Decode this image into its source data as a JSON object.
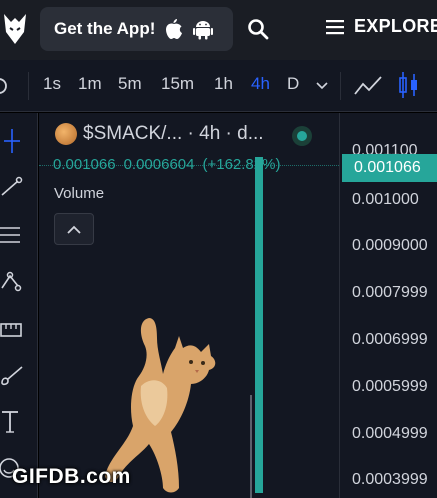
{
  "app": {
    "get_app_label": "Get the App!",
    "explore_label": "EXPLORE"
  },
  "toolbar": {
    "intervals": [
      "1s",
      "1m",
      "5m",
      "15m",
      "1h",
      "4h",
      "D"
    ],
    "active_interval": "4h"
  },
  "chart": {
    "symbol_title": "$SMACK/... · 4h · d...",
    "ohlc": {
      "value_a": "0.001066",
      "value_b": "0.0006604",
      "change": "(+162.82%)"
    },
    "volume_label": "Volume",
    "last_price_tag": "0.001066",
    "price_axis": [
      "0.001100",
      "0.001000",
      "0.0009000",
      "0.0007999",
      "0.0006999",
      "0.0005999",
      "0.0004999",
      "0.0003999"
    ],
    "colors": {
      "up": "#26a69a",
      "accent": "#2962ff",
      "background": "#131722"
    }
  },
  "watermark": "GIFDB.com"
}
